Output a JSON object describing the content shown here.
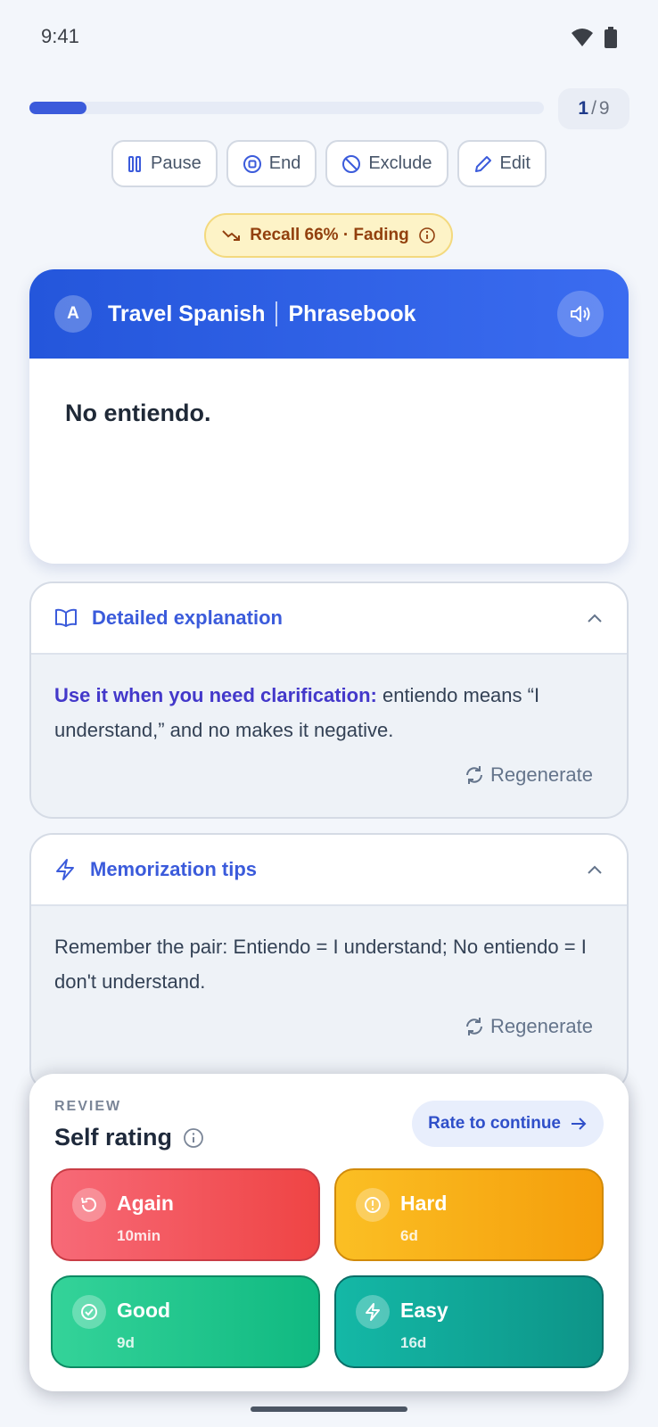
{
  "status_bar": {
    "time": "9:41",
    "icons": [
      "wifi-icon",
      "battery-icon"
    ]
  },
  "progress": {
    "fraction": 0.111,
    "current": "1",
    "separator": "/",
    "total": "9"
  },
  "toolbar": {
    "pause_label": "Pause",
    "end_label": "End",
    "exclude_label": "Exclude",
    "edit_label": "Edit"
  },
  "recall_badge": {
    "text": "Recall 66% · Fading",
    "icon": "trending-down-icon"
  },
  "card": {
    "deck_initial": "A",
    "deck_name": "Travel Spanish",
    "deck_section": "Phrasebook",
    "front_text": "No entiendo.",
    "header_color": "#2456db"
  },
  "explanation_panel": {
    "title": "Detailed explanation",
    "lead": "Use it when you need clarification:",
    "body": " entiendo means “I understand,” and no makes it negative.",
    "regenerate_label": "Regenerate"
  },
  "tips_panel": {
    "title": "Memorization tips",
    "body": "Remember the pair: Entiendo = I understand; No entiendo = I don't understand.",
    "regenerate_label": "Regenerate"
  },
  "review": {
    "kicker": "REVIEW",
    "title": "Self rating",
    "continue_label": "Rate to continue",
    "ratings": [
      {
        "label": "Again",
        "interval": "10min",
        "icon": "rotate-ccw-icon",
        "color": "#ef4444"
      },
      {
        "label": "Hard",
        "interval": "6d",
        "icon": "alert-circle-icon",
        "color": "#f59e0b"
      },
      {
        "label": "Good",
        "interval": "9d",
        "icon": "check-circle-icon",
        "color": "#10b981"
      },
      {
        "label": "Easy",
        "interval": "16d",
        "icon": "zap-icon",
        "color": "#0d9488"
      }
    ]
  },
  "colors": {
    "accent": "#3b5bdb",
    "background": "#f3f6fb"
  }
}
